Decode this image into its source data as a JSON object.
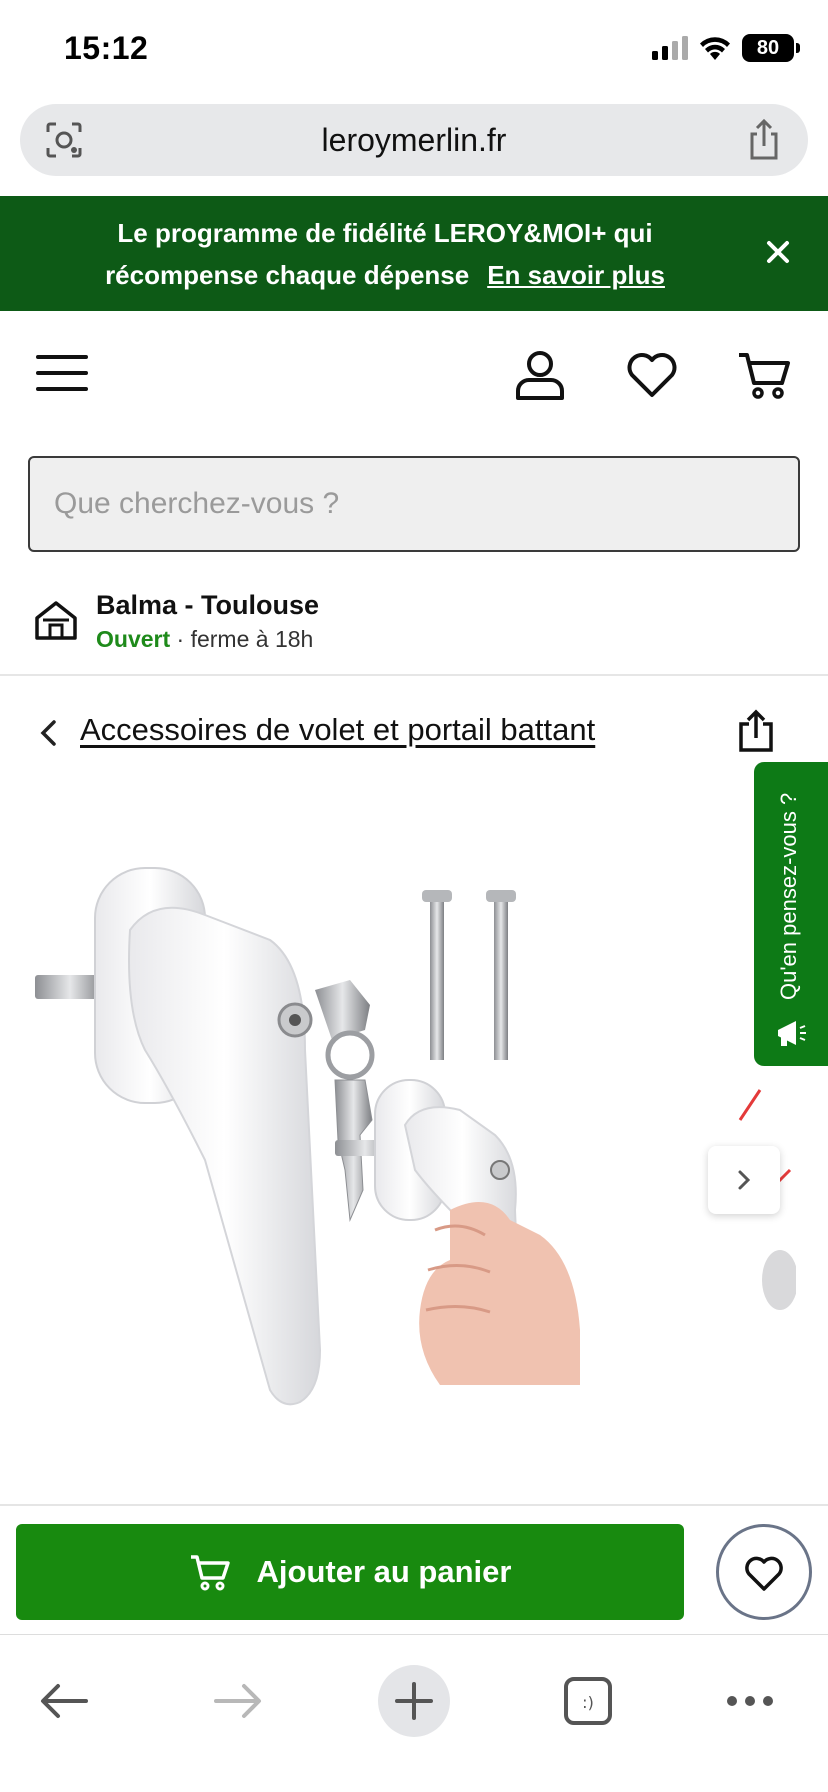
{
  "status_bar": {
    "time": "15:12",
    "battery": "80"
  },
  "browser": {
    "url": "leroymerlin.fr"
  },
  "banner": {
    "line1": "Le programme de fidélité LEROY&MOI+ qui",
    "line2": "récompense chaque dépense",
    "link": "En savoir plus"
  },
  "search": {
    "placeholder": "Que cherchez-vous ?"
  },
  "store": {
    "name": "Balma - Toulouse",
    "open_status": "Ouvert",
    "hours": " · ferme à 18h"
  },
  "breadcrumb": {
    "label": "Accessoires de volet et portail battant"
  },
  "feedback": {
    "label": "Qu'en pensez-vous ?"
  },
  "cart": {
    "add_label": "Ajouter au panier"
  },
  "colors": {
    "brand_green": "#188a0f",
    "banner_green": "#0d5a16",
    "open_green": "#1e8a1a"
  }
}
